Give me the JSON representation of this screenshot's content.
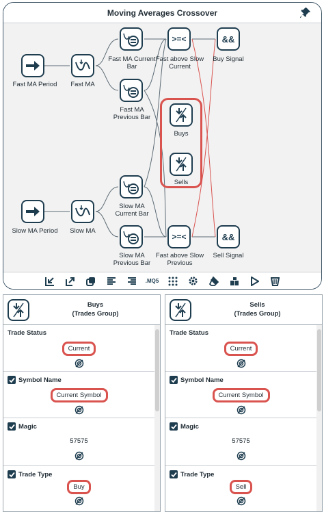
{
  "window": {
    "title": "Moving Averages Crossover"
  },
  "graph": {
    "nodes": {
      "fast_ma_period": "Fast MA Period",
      "fast_ma": "Fast MA",
      "fast_ma_current_bar": "Fast MA Current\nBar",
      "fast_ma_previous_bar": "Fast MA\nPrevious Bar",
      "fast_above_slow_current": "Fast above Slow\nCurrent",
      "buy_signal": "Buy Signal",
      "buys": "Buys",
      "sells": "Sells",
      "slow_ma_period": "Slow MA Period",
      "slow_ma": "Slow MA",
      "slow_ma_current_bar": "Slow MA\nCurrent Bar",
      "slow_ma_previous_bar": "Slow MA\nPrevious Bar",
      "fast_above_slow_previous": "Fast above Slow\nPrevious",
      "sell_signal": "Sell Signal"
    },
    "symbols": {
      "compare": ">=<",
      "and": "&&"
    }
  },
  "toolbar": {
    "mq5_label": ".MQ5"
  },
  "panels": [
    {
      "title": "Buys\n(Trades Group)",
      "fields": [
        {
          "label": "Trade Status",
          "value": "Current",
          "checked": false,
          "boxed": true
        },
        {
          "label": "Symbol Name",
          "value": "Current Symbol",
          "checked": true,
          "boxed": true
        },
        {
          "label": "Magic",
          "value": "57575",
          "checked": true,
          "boxed": false
        },
        {
          "label": "Trade Type",
          "value": "Buy",
          "checked": true,
          "boxed": true
        }
      ]
    },
    {
      "title": "Sells\n(Trades Group)",
      "fields": [
        {
          "label": "Trade Status",
          "value": "Current",
          "checked": false,
          "boxed": true
        },
        {
          "label": "Symbol Name",
          "value": "Current Symbol",
          "checked": true,
          "boxed": true
        },
        {
          "label": "Magic",
          "value": "57575",
          "checked": true,
          "boxed": false
        },
        {
          "label": "Trade Type",
          "value": "Sell",
          "checked": true,
          "boxed": true
        }
      ]
    }
  ],
  "colors": {
    "node_border": "#1e3d4f",
    "highlight": "#d9534f",
    "link_gray": "#5c6b75",
    "link_red": "#d9534f"
  }
}
